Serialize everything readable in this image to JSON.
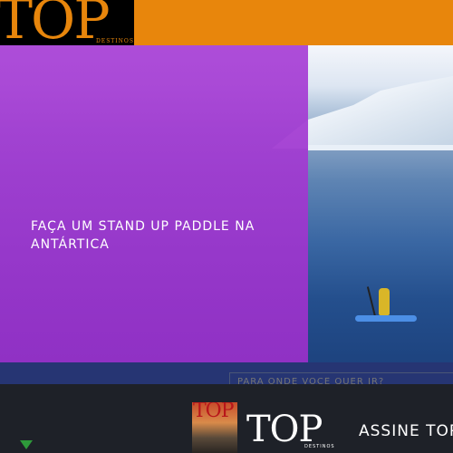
{
  "header": {
    "logo": "TOP",
    "logo_sub": "DESTINOS"
  },
  "hero": {
    "title": "FAÇA UM STAND UP PADDLE NA ANTÁRTICA"
  },
  "search": {
    "placeholder": "PARA ONDE VOCÊ QUER IR?"
  },
  "promo": {
    "cover_logo": "TOP",
    "brand": "TOP",
    "brand_sub": "DESTINOS",
    "cta": "ASSINE TOP"
  },
  "colors": {
    "header": "#e8860c",
    "overlay": "#a840d6",
    "band": "#263573",
    "bottom": "#1e2128"
  }
}
